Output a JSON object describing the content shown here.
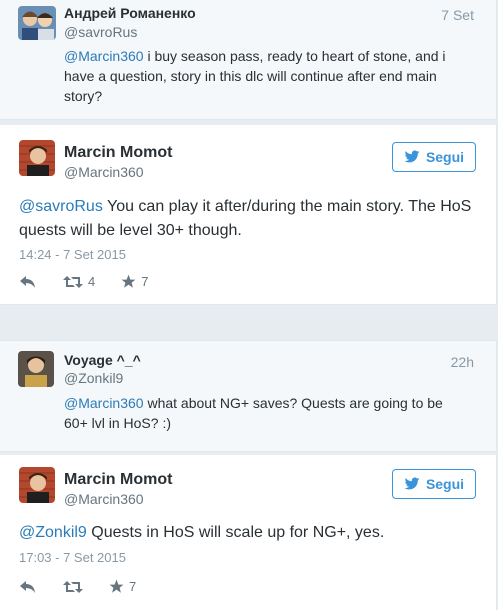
{
  "tweets": [
    {
      "kind": "reply",
      "author": "Андрей Романенко",
      "handle": "@savroRus",
      "time": "7 Set",
      "mention": "@Marcin360",
      "text": " i buy season pass, ready to heart of stone, and i",
      "text2": "have a question, story in this dlc will continue after end main",
      "text3": "story?"
    },
    {
      "kind": "main",
      "author": "Marcin Momot",
      "handle": "@Marcin360",
      "follow": "Segui",
      "mention": "@savroRus",
      "text": " You can play it after/during the main story. The HoS",
      "text2": "quests will be level 30+ though.",
      "timestamp": "14:24 - 7 Set 2015",
      "retweets": "4",
      "favorites": "7"
    },
    {
      "kind": "reply",
      "author": "Voyage ^_^",
      "handle": "@Zonkil9",
      "time": "22h",
      "mention": "@Marcin360",
      "text": " what about NG+ saves? Quests are going to be",
      "text2": "60+ lvl in HoS? :)"
    },
    {
      "kind": "main",
      "author": "Marcin Momot",
      "handle": "@Marcin360",
      "follow": "Segui",
      "mention": "@Zonkil9",
      "text": " Quests in HoS will scale up for NG+, yes.",
      "timestamp": "17:03 - 7 Set 2015",
      "favorites": "7"
    }
  ],
  "colors": {
    "link": "#2b7bb9",
    "follow": "#3b94d9",
    "background": "#e6ecf0"
  },
  "icons": [
    "reply-icon",
    "retweet-icon",
    "star-icon",
    "twitter-bird-icon"
  ]
}
